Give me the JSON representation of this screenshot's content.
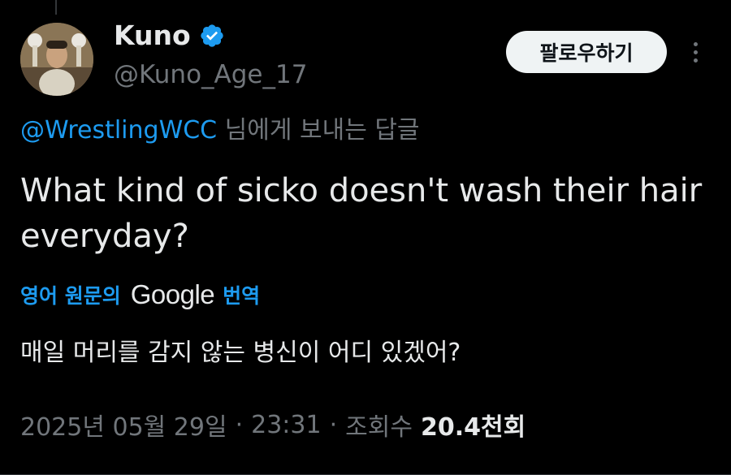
{
  "author": {
    "display_name": "Kuno",
    "handle": "@Kuno_Age_17",
    "verified_icon": "verified-badge-icon"
  },
  "actions": {
    "follow_label": "팔로우하기",
    "more_icon": "more-options-icon"
  },
  "reply_to": {
    "mention": "@WrestlingWCC",
    "suffix": " 님에게 보내는 답글"
  },
  "tweet": {
    "text": "What kind of sicko doesn't wash their hair everyday?",
    "translate_prefix": "영어 원문의",
    "translate_brand": "Google",
    "translate_suffix": "번역",
    "translated_text": "매일 머리를 감지 않는 병신이 어디 있겠어?"
  },
  "meta": {
    "date": "2025년 05월 29일",
    "separator": "·",
    "time": "23:31",
    "views_label": "조회수",
    "views_count": "20.4천회"
  },
  "colors": {
    "background": "#000000",
    "primary_text": "#e7e9ea",
    "secondary_text": "#71767b",
    "link": "#1d9bf0",
    "follow_button_bg": "#eff3f4",
    "follow_button_text": "#0f1419"
  }
}
